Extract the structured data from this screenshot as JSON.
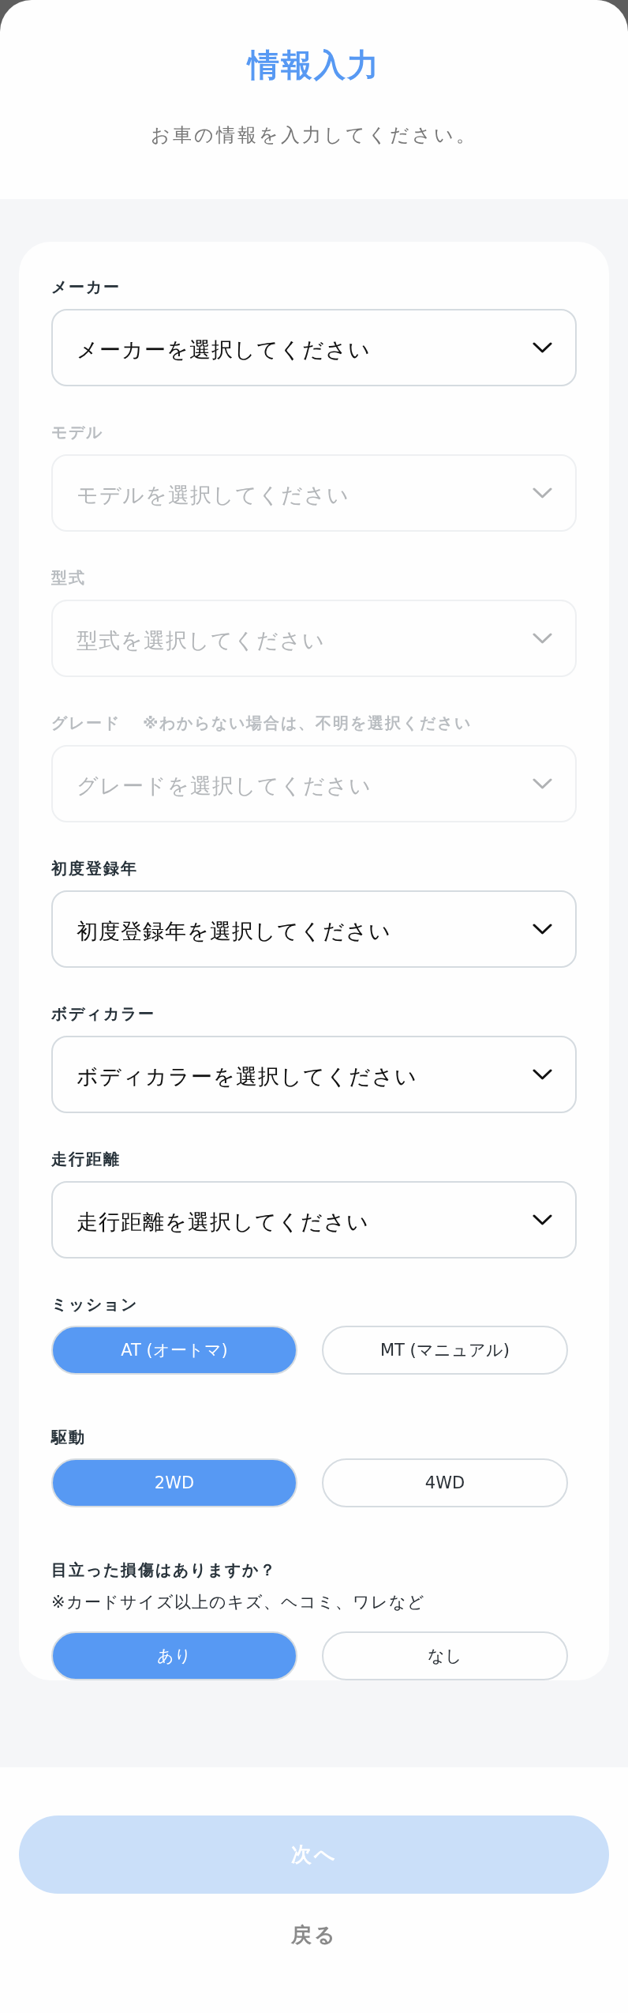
{
  "header": {
    "title": "情報入力",
    "subtitle": "お車の情報を入力してください。"
  },
  "form": {
    "fields": [
      {
        "kind": "select",
        "label": "メーカー",
        "placeholder": "メーカーを選択してください",
        "disabled": false
      },
      {
        "kind": "select",
        "label": "モデル",
        "placeholder": "モデルを選択してください",
        "disabled": true
      },
      {
        "kind": "select",
        "label": "型式",
        "placeholder": "型式を選択してください",
        "disabled": true
      },
      {
        "kind": "select",
        "label": "グレード",
        "note": "※わからない場合は、不明を選択ください",
        "placeholder": "グレードを選択してください",
        "disabled": true
      },
      {
        "kind": "select",
        "label": "初度登録年",
        "placeholder": "初度登録年を選択してください",
        "disabled": false
      },
      {
        "kind": "select",
        "label": "ボディカラー",
        "placeholder": "ボディカラーを選択してください",
        "disabled": false
      },
      {
        "kind": "select",
        "label": "走行距離",
        "placeholder": "走行距離を選択してください",
        "disabled": false
      },
      {
        "kind": "choice",
        "label": "ミッション",
        "options": [
          {
            "label": "AT (オートマ)",
            "selected": true
          },
          {
            "label": "MT (マニュアル)",
            "selected": false
          }
        ]
      },
      {
        "kind": "choice",
        "label": "駆動",
        "options": [
          {
            "label": "2WD",
            "selected": true
          },
          {
            "label": "4WD",
            "selected": false
          }
        ]
      },
      {
        "kind": "choice",
        "label": "目立った損傷はありますか？",
        "note": "※カードサイズ以上のキズ、ヘコミ、ワレなど",
        "options": [
          {
            "label": "あり",
            "selected": true
          },
          {
            "label": "なし",
            "selected": false
          }
        ]
      }
    ]
  },
  "footer": {
    "next_button": {
      "label": "次へ",
      "disabled": true
    },
    "back_link": {
      "label": "戻る"
    }
  }
}
